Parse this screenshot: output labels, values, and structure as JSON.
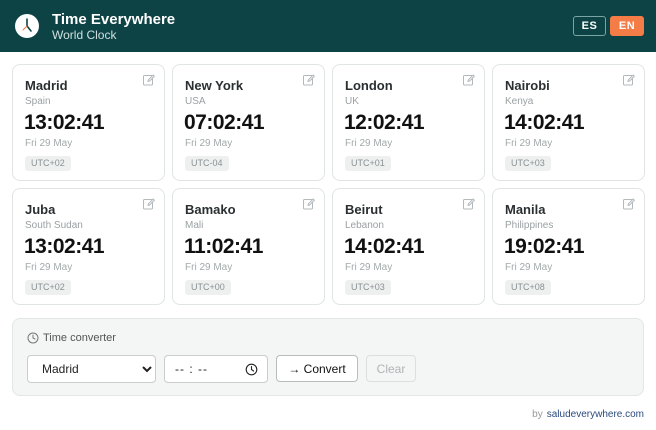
{
  "header": {
    "title": "Time Everywhere",
    "subtitle": "World Clock",
    "languages": [
      {
        "code": "ES",
        "active": false
      },
      {
        "code": "EN",
        "active": true
      }
    ],
    "colors": {
      "background": "#0e4345",
      "accent": "#f47c46"
    }
  },
  "clocks": [
    {
      "city": "Madrid",
      "country": "Spain",
      "time": "13:02:41",
      "date": "Fri 29 May",
      "utc": "UTC+02"
    },
    {
      "city": "New York",
      "country": "USA",
      "time": "07:02:41",
      "date": "Fri 29 May",
      "utc": "UTC-04"
    },
    {
      "city": "London",
      "country": "UK",
      "time": "12:02:41",
      "date": "Fri 29 May",
      "utc": "UTC+01"
    },
    {
      "city": "Nairobi",
      "country": "Kenya",
      "time": "14:02:41",
      "date": "Fri 29 May",
      "utc": "UTC+03"
    },
    {
      "city": "Juba",
      "country": "South Sudan",
      "time": "13:02:41",
      "date": "Fri 29 May",
      "utc": "UTC+02"
    },
    {
      "city": "Bamako",
      "country": "Mali",
      "time": "11:02:41",
      "date": "Fri 29 May",
      "utc": "UTC+00"
    },
    {
      "city": "Beirut",
      "country": "Lebanon",
      "time": "14:02:41",
      "date": "Fri 29 May",
      "utc": "UTC+03"
    },
    {
      "city": "Manila",
      "country": "Philippines",
      "time": "19:02:41",
      "date": "Fri 29 May",
      "utc": "UTC+08"
    }
  ],
  "converter": {
    "title": "Time converter",
    "selected_city": "Madrid",
    "time_placeholder": "-- : --",
    "convert_label": "→ Convert",
    "clear_label": "Clear"
  },
  "footer": {
    "prefix": "by",
    "link": "saludeverywhere.com"
  },
  "icons": {
    "logo": "clock-icon",
    "edit": "pencil-edit-icon",
    "converter": "clock-outline-icon",
    "time_input": "clock-outline-icon"
  }
}
